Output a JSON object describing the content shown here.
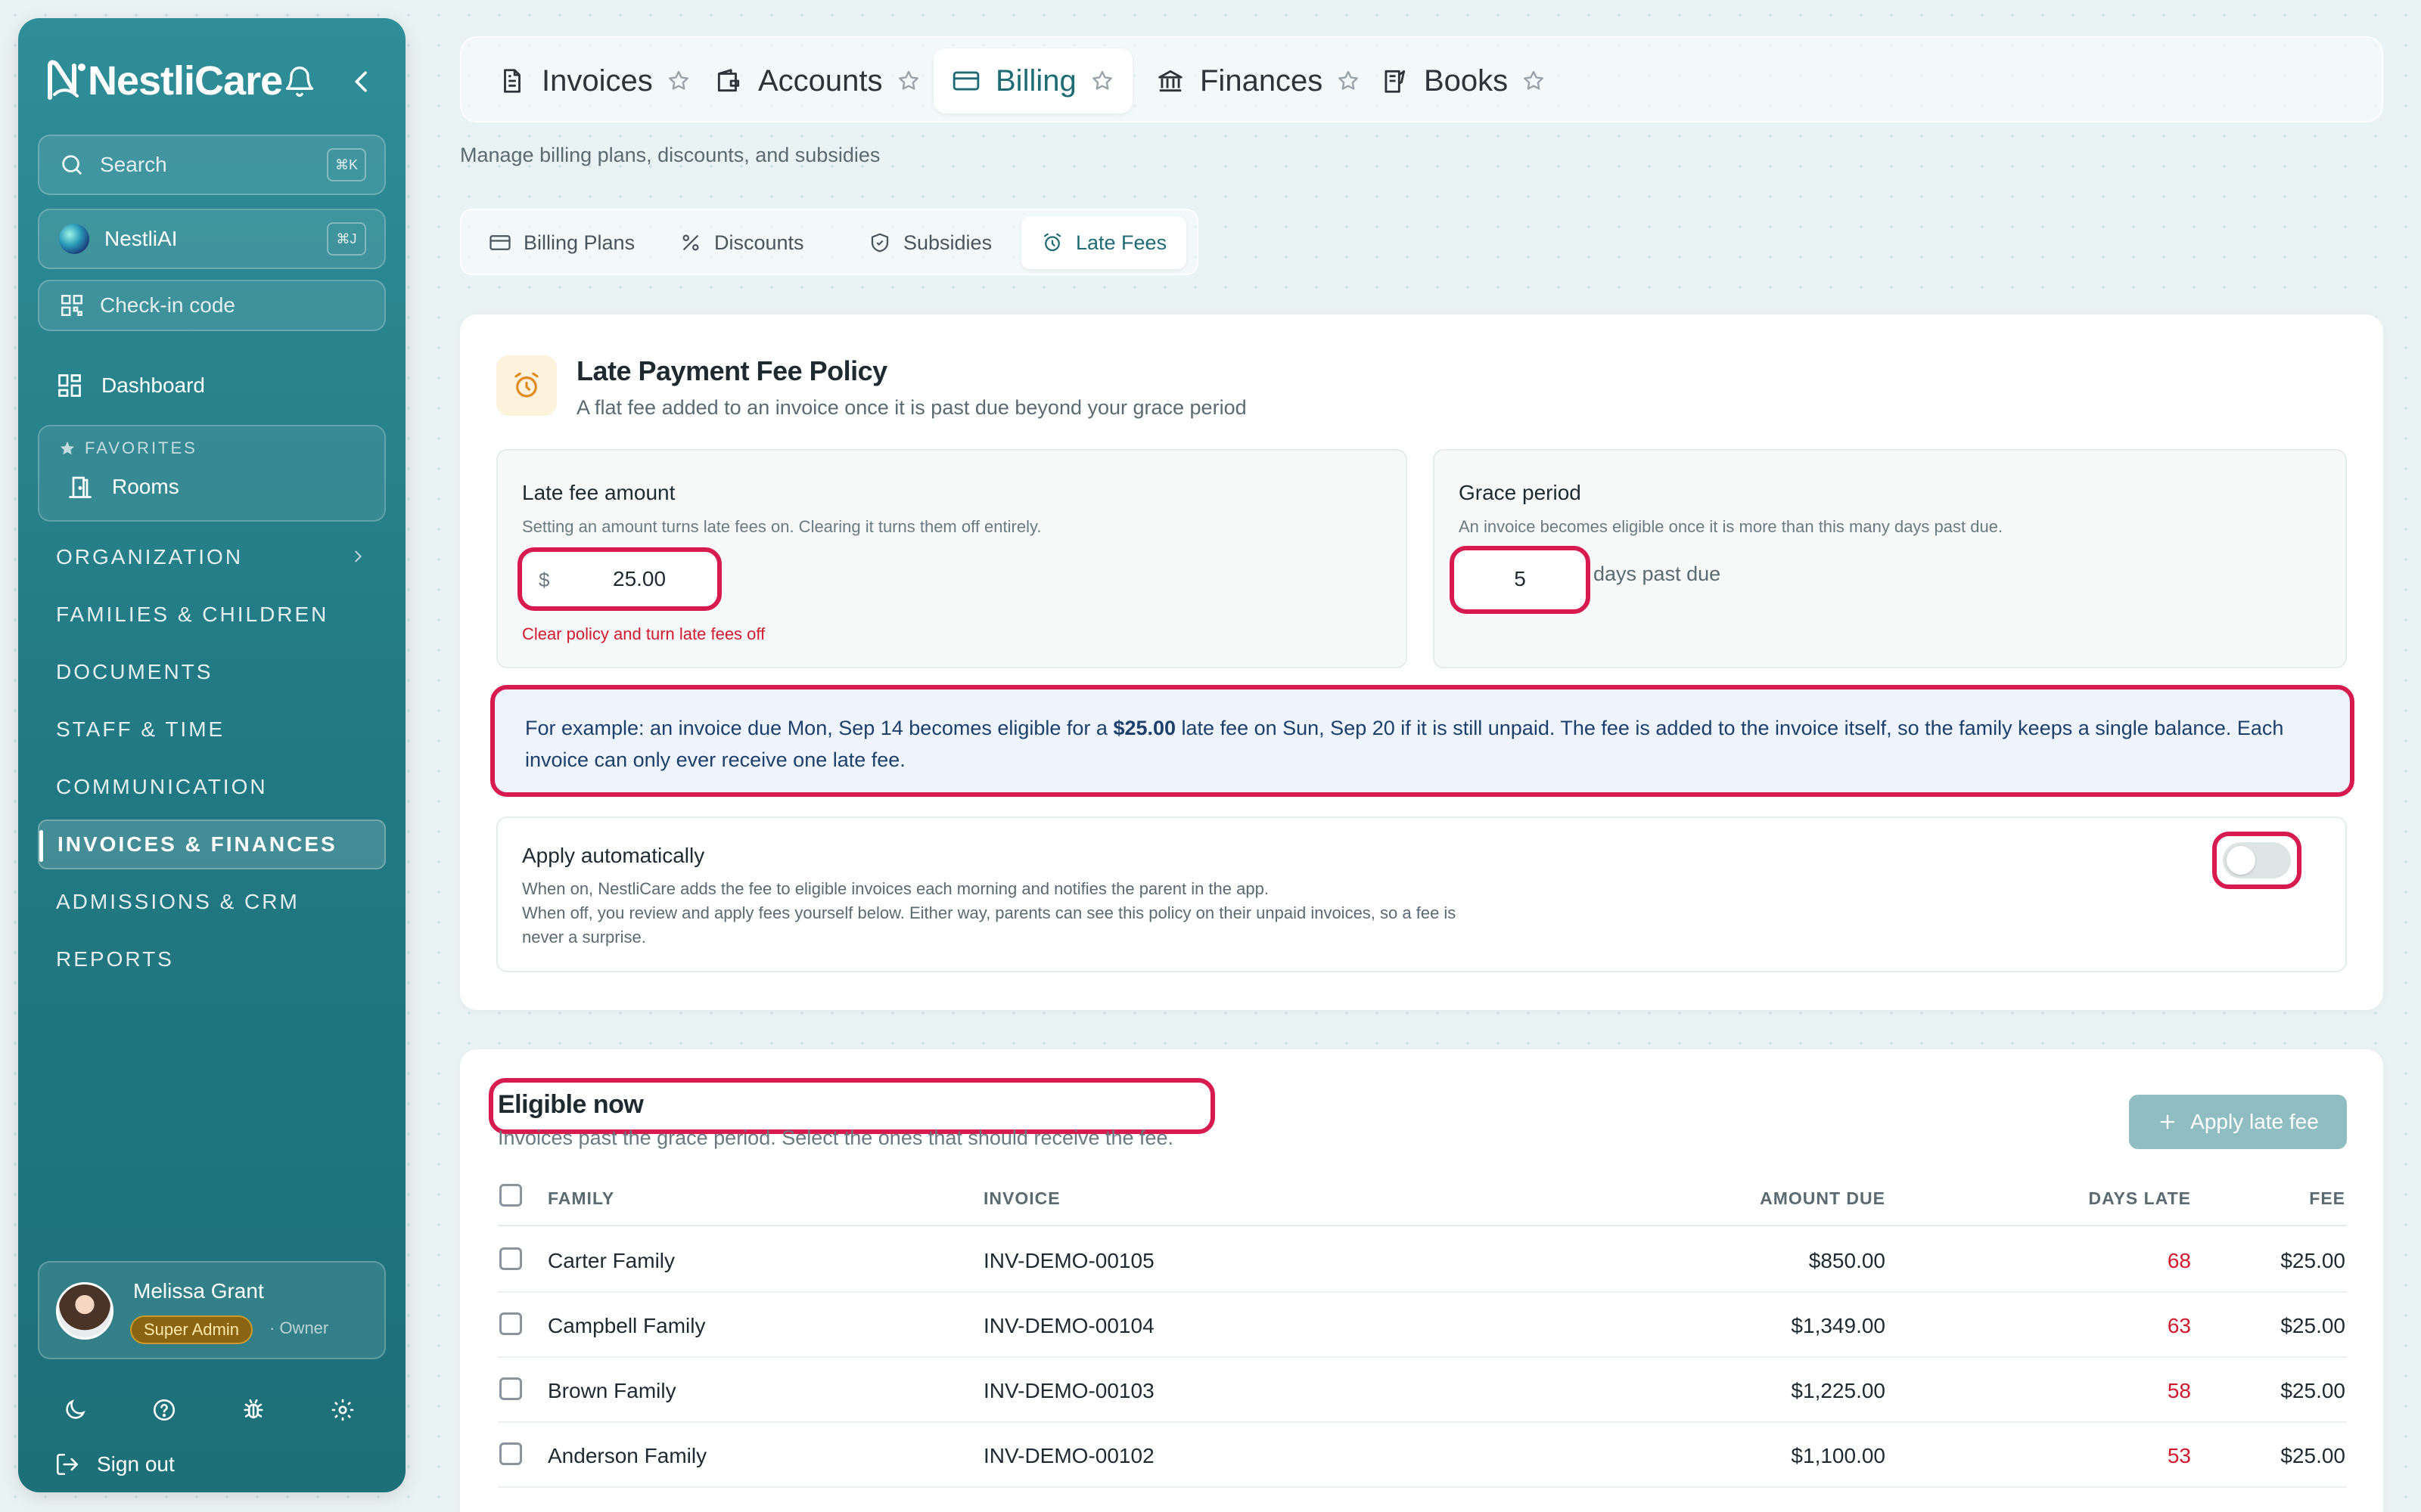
{
  "sidebar": {
    "brand": "NestliCare",
    "search": {
      "label": "Search",
      "shortcut": "⌘K"
    },
    "ai": {
      "label": "NestliAI",
      "shortcut": "⌘J"
    },
    "checkin": "Check-in code",
    "dashboard": "Dashboard",
    "favorites": {
      "label": "FAVORITES",
      "items": [
        "Rooms"
      ]
    },
    "sections": [
      "ORGANIZATION",
      "FAMILIES & CHILDREN",
      "DOCUMENTS",
      "STAFF & TIME",
      "COMMUNICATION",
      "INVOICES & FINANCES",
      "ADMISSIONS & CRM",
      "REPORTS"
    ],
    "active_section": "INVOICES & FINANCES",
    "user": {
      "name": "Melissa Grant",
      "role": "Super Admin",
      "subrole": "· Owner"
    },
    "signout": "Sign out"
  },
  "top_tabs": [
    {
      "label": "Invoices",
      "icon": "document-icon"
    },
    {
      "label": "Accounts",
      "icon": "wallet-icon"
    },
    {
      "label": "Billing",
      "icon": "credit-card-icon",
      "active": true
    },
    {
      "label": "Finances",
      "icon": "bank-icon"
    },
    {
      "label": "Books",
      "icon": "book-icon"
    }
  ],
  "page_subtitle": "Manage billing plans, discounts, and subsidies",
  "sub_tabs": [
    {
      "label": "Billing Plans",
      "icon": "credit-card-icon"
    },
    {
      "label": "Discounts",
      "icon": "percent-icon"
    },
    {
      "label": "Subsidies",
      "icon": "shield-icon"
    },
    {
      "label": "Late Fees",
      "icon": "alarm-icon",
      "active": true
    }
  ],
  "policy": {
    "title": "Late Payment Fee Policy",
    "description": "A flat fee added to an invoice once it is past due beyond your grace period",
    "fee": {
      "title": "Late fee amount",
      "hint": "Setting an amount turns late fees on. Clearing it turns them off entirely.",
      "currency": "$",
      "value": "25.00",
      "clear_link": "Clear policy and turn late fees off"
    },
    "grace": {
      "title": "Grace period",
      "hint": "An invoice becomes eligible once it is more than this many days past due.",
      "value": "5",
      "suffix": "days past due"
    },
    "example": {
      "pre": "For example: an invoice due Mon, Sep 14 becomes eligible for a ",
      "amount": "$25.00",
      "post": " late fee on Sun, Sep 20 if it is still unpaid. The fee is added to the invoice itself, so the family keeps a single balance. Each invoice can only ever receive one late fee."
    },
    "auto": {
      "title": "Apply automatically",
      "line1": "When on, NestliCare adds the fee to eligible invoices each morning and notifies the parent in the app.",
      "line2": "When off, you review and apply fees yourself below. Either way, parents can see this policy on their unpaid invoices, so a fee is never a surprise.",
      "enabled": false
    }
  },
  "eligible": {
    "title": "Eligible now",
    "subtitle": "Invoices past the grace period. Select the ones that should receive the fee.",
    "apply_button": "Apply late fee",
    "columns": [
      "FAMILY",
      "INVOICE",
      "AMOUNT DUE",
      "DAYS LATE",
      "FEE"
    ],
    "rows": [
      {
        "family": "Carter Family",
        "invoice": "INV-DEMO-00105",
        "amount": "$850.00",
        "days": "68",
        "fee": "$25.00"
      },
      {
        "family": "Campbell Family",
        "invoice": "INV-DEMO-00104",
        "amount": "$1,349.00",
        "days": "63",
        "fee": "$25.00"
      },
      {
        "family": "Brown Family",
        "invoice": "INV-DEMO-00103",
        "amount": "$1,225.00",
        "days": "58",
        "fee": "$25.00"
      },
      {
        "family": "Anderson Family",
        "invoice": "INV-DEMO-00102",
        "amount": "$1,100.00",
        "days": "53",
        "fee": "$25.00"
      }
    ]
  },
  "colors": {
    "accent": "#1f6b74",
    "highlight": "#d81b4f",
    "late": "#d21a2e",
    "sidebar": "#237a84"
  }
}
